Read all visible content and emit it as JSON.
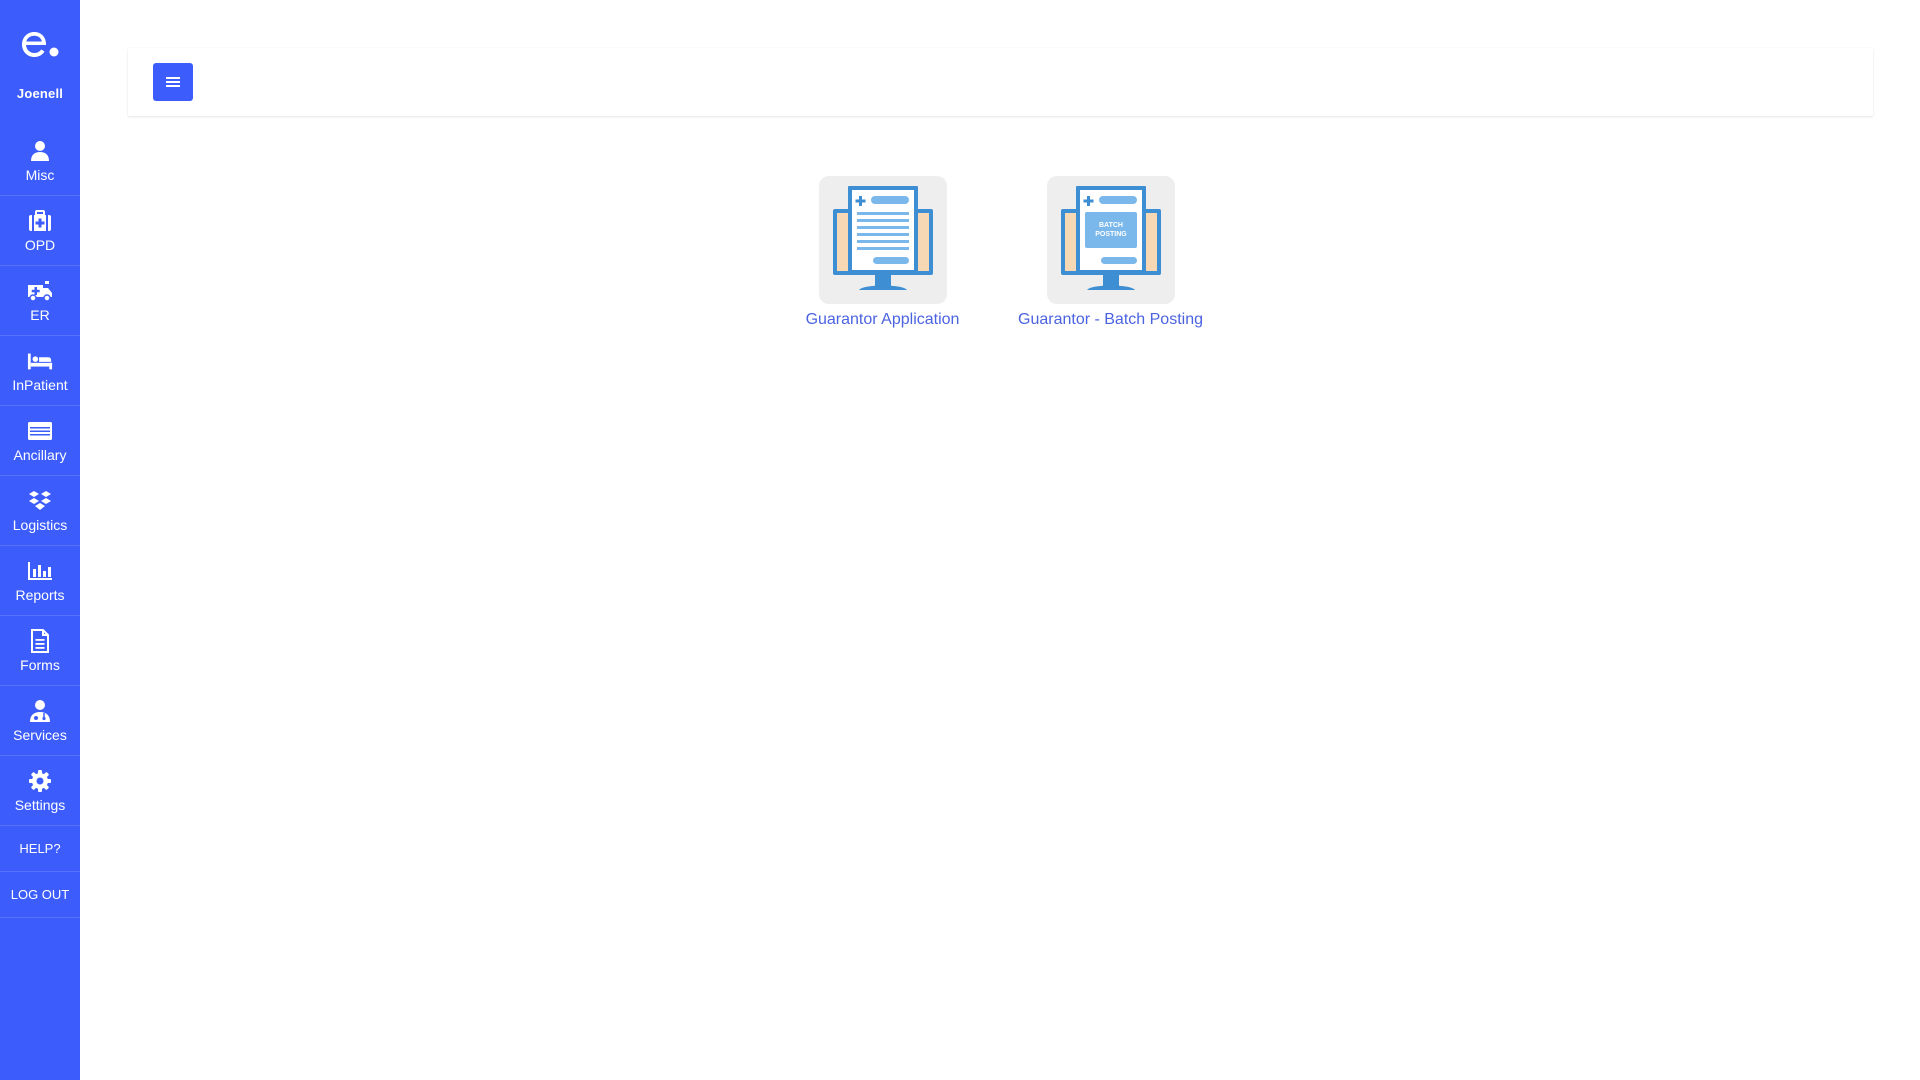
{
  "app": {
    "logo_icon": "e-dot-logo-icon",
    "user": "Joenell",
    "accent_color": "#3c5dfb"
  },
  "sidebar": {
    "items": [
      {
        "label": "Misc",
        "icon": "user-icon"
      },
      {
        "label": "OPD",
        "icon": "medical-kit-icon"
      },
      {
        "label": "ER",
        "icon": "ambulance-icon"
      },
      {
        "label": "InPatient",
        "icon": "bed-icon"
      },
      {
        "label": "Ancillary",
        "icon": "list-card-icon"
      },
      {
        "label": "Logistics",
        "icon": "boxes-icon"
      },
      {
        "label": "Reports",
        "icon": "bar-chart-icon"
      },
      {
        "label": "Forms",
        "icon": "document-icon"
      },
      {
        "label": "Services",
        "icon": "doctor-icon"
      },
      {
        "label": "Settings",
        "icon": "gear-icon"
      }
    ],
    "help_label": "HELP?",
    "logout_label": "LOG OUT"
  },
  "topbar": {
    "menu_icon": "hamburger-icon"
  },
  "tiles": [
    {
      "caption": "Guarantor Application",
      "icon": "monitor-document-icon"
    },
    {
      "caption": "Guarantor - Batch Posting",
      "icon": "monitor-batch-posting-icon",
      "badge_text": "BATCH POSTING"
    }
  ]
}
